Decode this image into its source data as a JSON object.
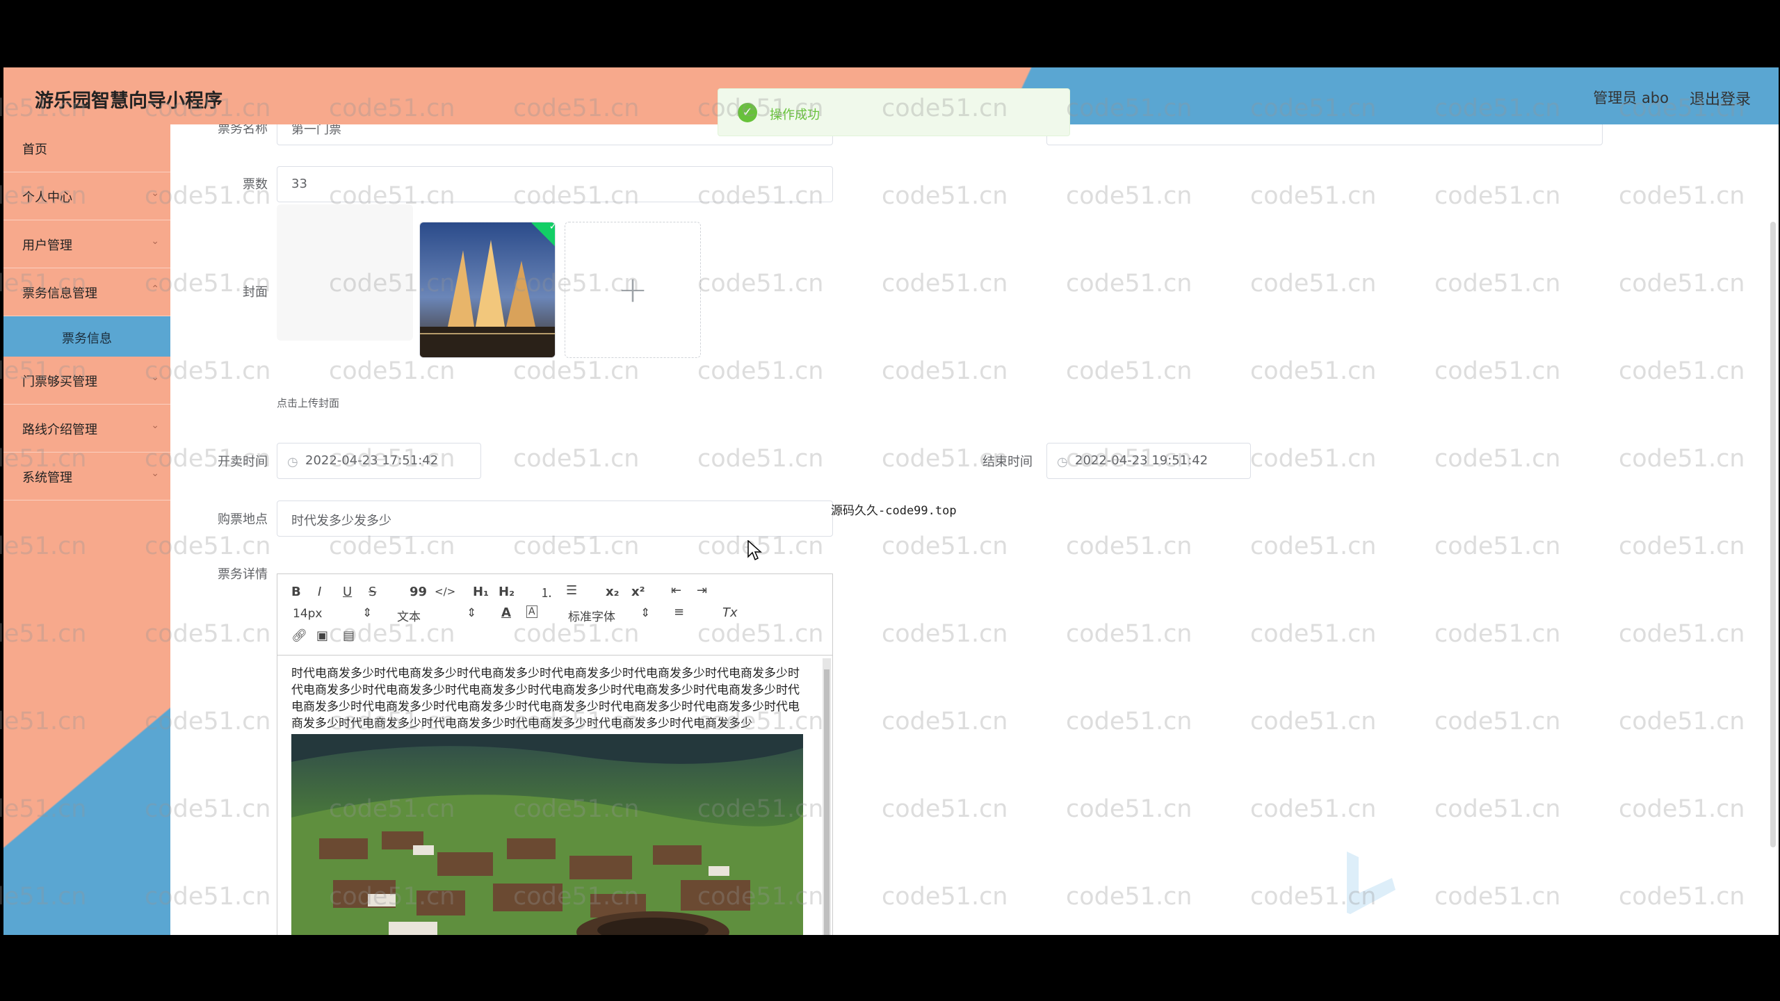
{
  "app": {
    "title": "游乐园智慧向导小程序"
  },
  "header": {
    "user_label": "管理员 abo",
    "logout_label": "退出登录"
  },
  "sidebar": {
    "items": [
      {
        "label": "首页",
        "has_chevron": false
      },
      {
        "label": "个人中心",
        "has_chevron": true
      },
      {
        "label": "用户管理",
        "has_chevron": true
      },
      {
        "label": "票务信息管理",
        "has_chevron": true
      },
      {
        "label": "门票够买管理",
        "has_chevron": true
      },
      {
        "label": "路线介绍管理",
        "has_chevron": true
      },
      {
        "label": "系统管理",
        "has_chevron": true
      }
    ],
    "active_sub": "票务信息"
  },
  "form": {
    "ticket_name": {
      "label": "票务名称",
      "value": "第一门票"
    },
    "ticket_count": {
      "label": "票数",
      "value": "33"
    },
    "cover": {
      "label": "封面",
      "tip": "点击上传封面"
    },
    "start_time": {
      "label": "开卖时间",
      "value": "2022-04-23 17:51:42"
    },
    "end_time": {
      "label": "结束时间",
      "value": "2022-04-23 19:51:42"
    },
    "location": {
      "label": "购票地点",
      "value": "时代发多少发多少"
    },
    "detail": {
      "label": "票务详情"
    }
  },
  "editor": {
    "toolbar": {
      "bold": "B",
      "italic": "I",
      "underline": "U",
      "strike": "S",
      "quote": "99",
      "code": "</>",
      "h1": "H₁",
      "h2": "H₂",
      "sub": "x₂",
      "sup": "x²",
      "size": "14px",
      "type": "文本",
      "font": "标准字体",
      "clear": "Tx"
    },
    "content": "时代电商发多少时代电商发多少时代电商发多少时代电商发多少时代电商发多少时代电商发多少时代电商发多少时代电商发多少时代电商发多少时代电商发多少时代电商发多少时代电商发多少时代电商发多少时代电商发多少时代电商发多少时代电商发多少时代电商发多少时代电商发多少时代电商发多少时代电商发多少时代电商发多少时代电商发多少时代电商发多少时代电商发多少"
  },
  "toast": {
    "message": "操作成功"
  },
  "floating_note": "源码久久-code99.top",
  "watermark": "code51.cn",
  "colors": {
    "salmon": "#f7a98c",
    "blue": "#5aa6d2",
    "success": "#67c23a"
  }
}
